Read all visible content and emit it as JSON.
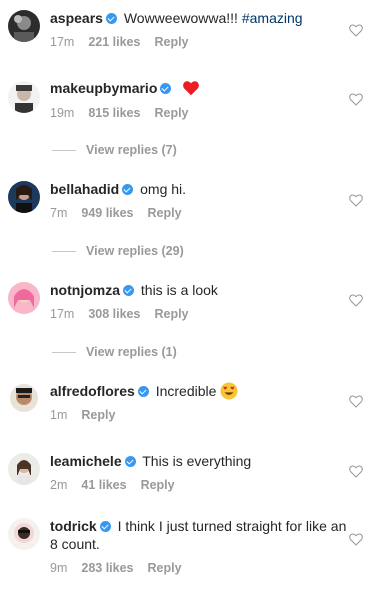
{
  "comments": [
    {
      "username": "aspears",
      "text": "Wowweewowwa!!! ",
      "hashtag": "#amazing",
      "time": "17m",
      "likes": "221 likes",
      "reply": "Reply"
    },
    {
      "username": "makeupbymario",
      "text": "",
      "time": "19m",
      "likes": "815 likes",
      "reply": "Reply",
      "view_replies": "View replies (7)"
    },
    {
      "username": "bellahadid",
      "text": "omg hi.",
      "time": "7m",
      "likes": "949 likes",
      "reply": "Reply",
      "view_replies": "View replies (29)"
    },
    {
      "username": "notnjomza",
      "text": "this is a look",
      "time": "17m",
      "likes": "308 likes",
      "reply": "Reply",
      "view_replies": "View replies (1)"
    },
    {
      "username": "alfredoflores",
      "text": "Incredible",
      "time": "1m",
      "likes": "",
      "reply": "Reply"
    },
    {
      "username": "leamichele",
      "text": "This is everything",
      "time": "2m",
      "likes": "41 likes",
      "reply": "Reply"
    },
    {
      "username": "todrick",
      "text": "I think I just turned straight for like an 8 count.",
      "time": "9m",
      "likes": "283 likes",
      "reply": "Reply"
    }
  ],
  "colors": {
    "verified": "#3897f0",
    "muted": "#999999",
    "hashtag": "#003569",
    "heart_emoji": "#ed1c24"
  }
}
